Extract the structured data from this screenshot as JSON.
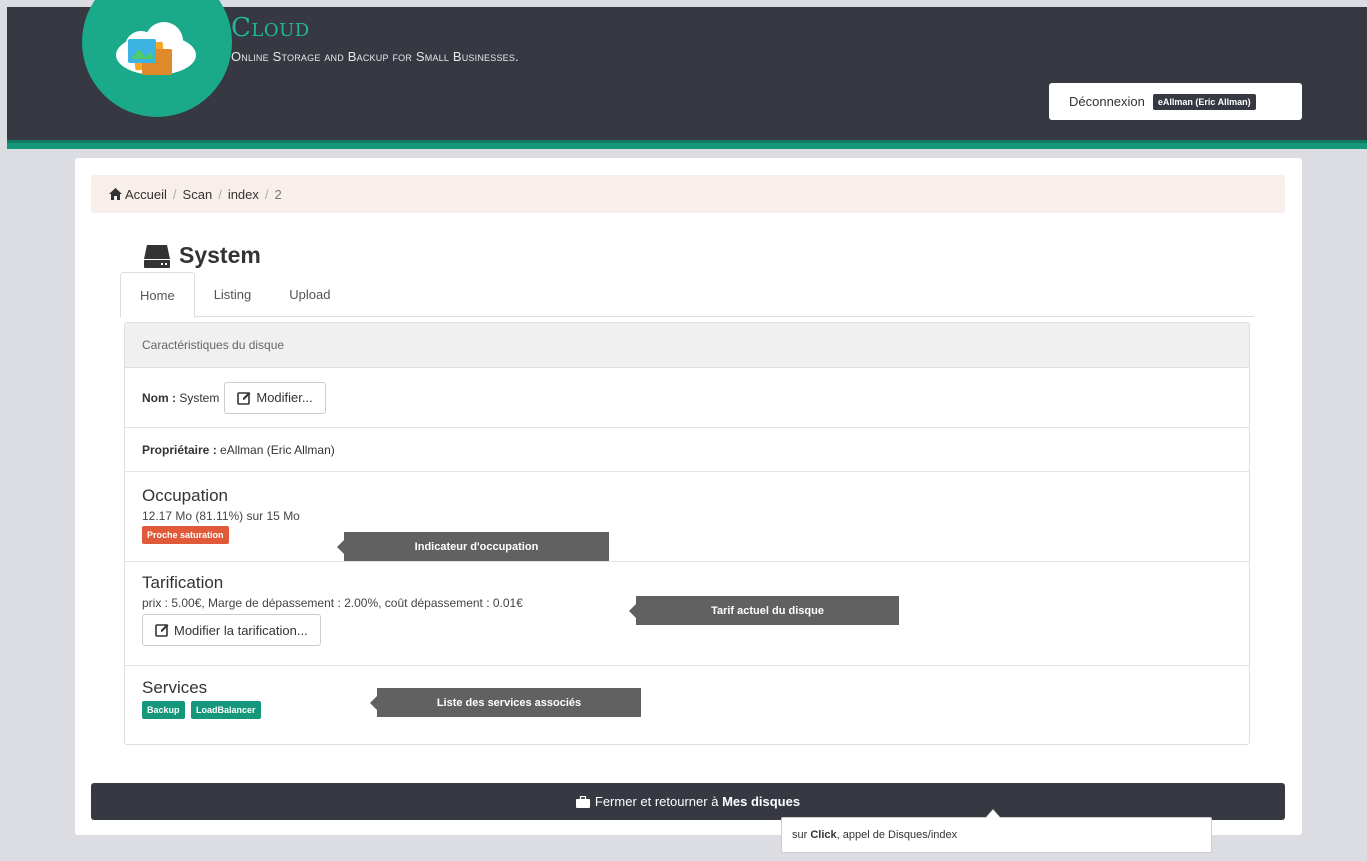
{
  "brand": {
    "title": "Cloud",
    "subtitle": "Online Storage and Backup for Small Businesses."
  },
  "auth": {
    "logout_label": "Déconnexion",
    "user": "eAllman (Eric Allman)"
  },
  "breadcrumb": {
    "items": [
      "Accueil",
      "Scan",
      "index",
      "2"
    ]
  },
  "page": {
    "title": "System"
  },
  "tabs": [
    "Home",
    "Listing",
    "Upload"
  ],
  "card": {
    "header": "Caractéristiques du disque",
    "name_label": "Nom :",
    "name_value": "System",
    "modify_button": "Modifier...",
    "owner_label": "Propriétaire :",
    "owner_value": "eAllman (Eric Allman)",
    "occupation": {
      "title": "Occupation",
      "text": "12.17 Mo (81.11%) sur 15 Mo",
      "badge": "Proche saturation",
      "percent": 81.11
    },
    "tarification": {
      "title": "Tarification",
      "text": "prix : 5.00€, Marge de dépassement : 2.00%, coût dépassement : 0.01€",
      "button": "Modifier la tarification..."
    },
    "services": {
      "title": "Services",
      "items": [
        "Backup",
        "LoadBalancer"
      ]
    }
  },
  "tooltips": {
    "occupation": "Indicateur d'occupation",
    "tarif": "Tarif actuel du disque",
    "services": "Liste des services associés"
  },
  "close_bar": {
    "prefix": "Fermer et retourner à",
    "target": "Mes disques"
  },
  "bottom_tip": {
    "p1": "sur",
    "p2": "Click",
    "p3": ", appel de",
    "p4": "Disques/index"
  },
  "colors": {
    "header_bg": "#363842",
    "accent": "#14977a",
    "danger": "#e05a3a"
  }
}
